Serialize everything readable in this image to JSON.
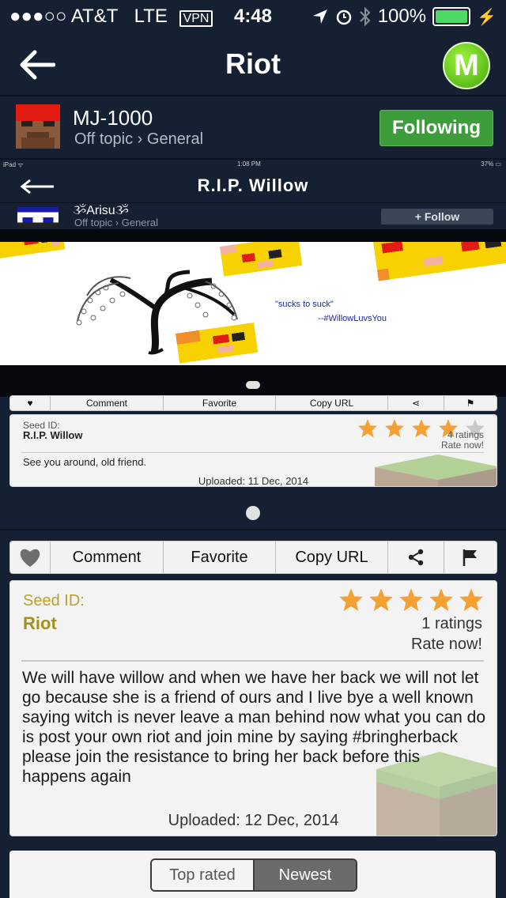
{
  "status": {
    "carrier": "●●●○○ AT&T",
    "network": "LTE",
    "vpn": "VPN",
    "time": "4:48",
    "battery": "100%"
  },
  "nav": {
    "title": "Riot",
    "logo_letter": "M"
  },
  "post": {
    "author": "MJ-1000",
    "breadcrumb": "Off topic › General",
    "follow_label": "Following"
  },
  "embedded": {
    "status": {
      "left": "iPad ᯤ",
      "time": "1:08 PM",
      "battery": "37% ▭"
    },
    "title": "R.I.P. Willow",
    "author": "ૐArisuૐ",
    "breadcrumb": "Off topic › General",
    "follow_label": "+ Follow",
    "image_text_1": "\"sucks to suck\"",
    "image_text_2": "--#WillowLuvsYou",
    "toolbar": {
      "comment": "Comment",
      "favorite": "Favorite",
      "copy_url": "Copy URL"
    },
    "seed_label": "Seed ID:",
    "seed_title": "R.I.P. Willow",
    "ratings": "4 ratings",
    "rate_now": "Rate now!",
    "description": "See you around, old friend.",
    "uploaded": "Uploaded: 11 Dec, 2014",
    "stars": 4
  },
  "toolbar": {
    "comment": "Comment",
    "favorite": "Favorite",
    "copy_url": "Copy URL"
  },
  "seed": {
    "label": "Seed ID:",
    "title": "Riot",
    "ratings": "1 ratings",
    "rate_now": "Rate now!",
    "stars": 5,
    "description": "We will have willow and when we have her back we will not let go because she is a friend of ours and I live bye a well known saying witch is never leave a man behind now what you can do is post your own riot and join mine by saying #bringherback please join the resistance to bring her back before this happens again",
    "uploaded": "Uploaded: 12 Dec, 2014"
  },
  "segment": {
    "top_rated": "Top rated",
    "newest": "Newest",
    "selected": "Newest"
  },
  "colors": {
    "background": "#152133",
    "follow_green": "#3c9d3a",
    "seed_gold": "#a5901b",
    "star_orange": "#f5a033"
  }
}
